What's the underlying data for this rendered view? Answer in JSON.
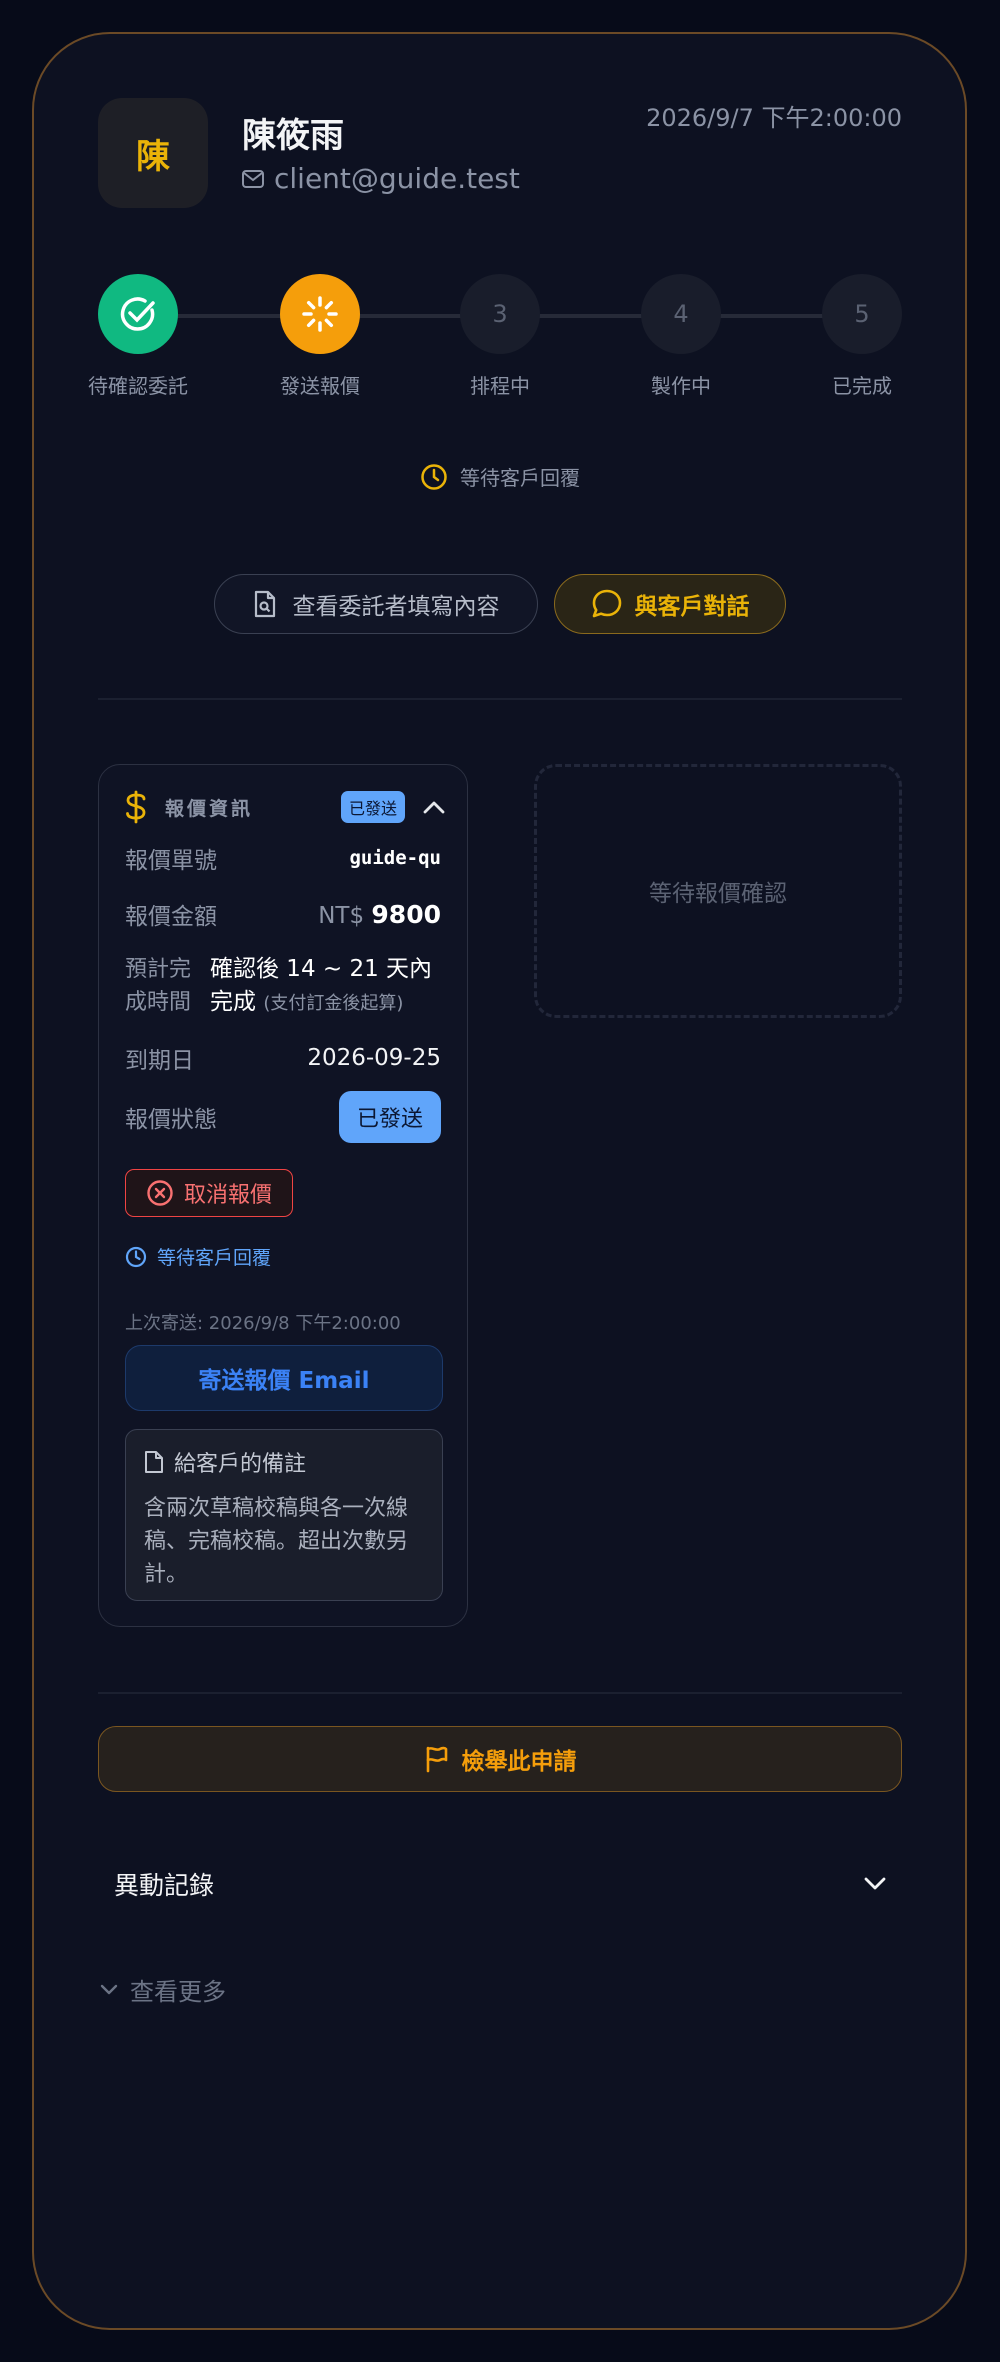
{
  "client": {
    "avatar_initial": "陳",
    "name": "陳筱雨",
    "email": "client@guide.test",
    "created_at": "2026/9/7 下午2:00:00"
  },
  "stepper": {
    "steps": [
      {
        "number": "1",
        "label": "待確認委託",
        "state": "done"
      },
      {
        "number": "2",
        "label": "發送報價",
        "state": "active"
      },
      {
        "number": "3",
        "label": "排程中",
        "state": "pending"
      },
      {
        "number": "4",
        "label": "製作中",
        "state": "pending"
      },
      {
        "number": "5",
        "label": "已完成",
        "state": "pending"
      }
    ],
    "status_text": "等待客戶回覆"
  },
  "actions": {
    "view_form_label": "查看委託者填寫內容",
    "chat_label": "與客戶對話"
  },
  "quote": {
    "header_title": "報價資訊",
    "header_badge": "已發送",
    "number_label": "報價單號",
    "number_value": "guide-qu",
    "amount_label": "報價金額",
    "amount_currency": "NT$",
    "amount_value": "9800",
    "estimate_label": "預計完成時間",
    "estimate_value": "確認後 14 ~ 21 天內完成",
    "estimate_note": "(支付訂金後起算)",
    "due_label": "到期日",
    "due_value": "2026-09-25",
    "status_label": "報價狀態",
    "status_value": "已發送",
    "cancel_label": "取消報價",
    "waiting_text": "等待客戶回覆",
    "last_sent": "上次寄送: 2026/9/8 下午2:00:00",
    "send_email_label": "寄送報價 Email",
    "note_title": "給客戶的備註",
    "note_body": "含兩次草稿校稿與各一次線稿、完稿校稿。超出次數另計。"
  },
  "waiting_confirm_text": "等待報價確認",
  "report_label": "檢舉此申請",
  "history_label": "異動記錄",
  "see_more_label": "查看更多",
  "colors": {
    "accent_gold": "#eab308",
    "accent_orange": "#f59e0b",
    "done_green": "#10b981",
    "info_blue": "#60a5fa",
    "danger_red": "#ef4444",
    "border_brown": "#6b4a26"
  }
}
